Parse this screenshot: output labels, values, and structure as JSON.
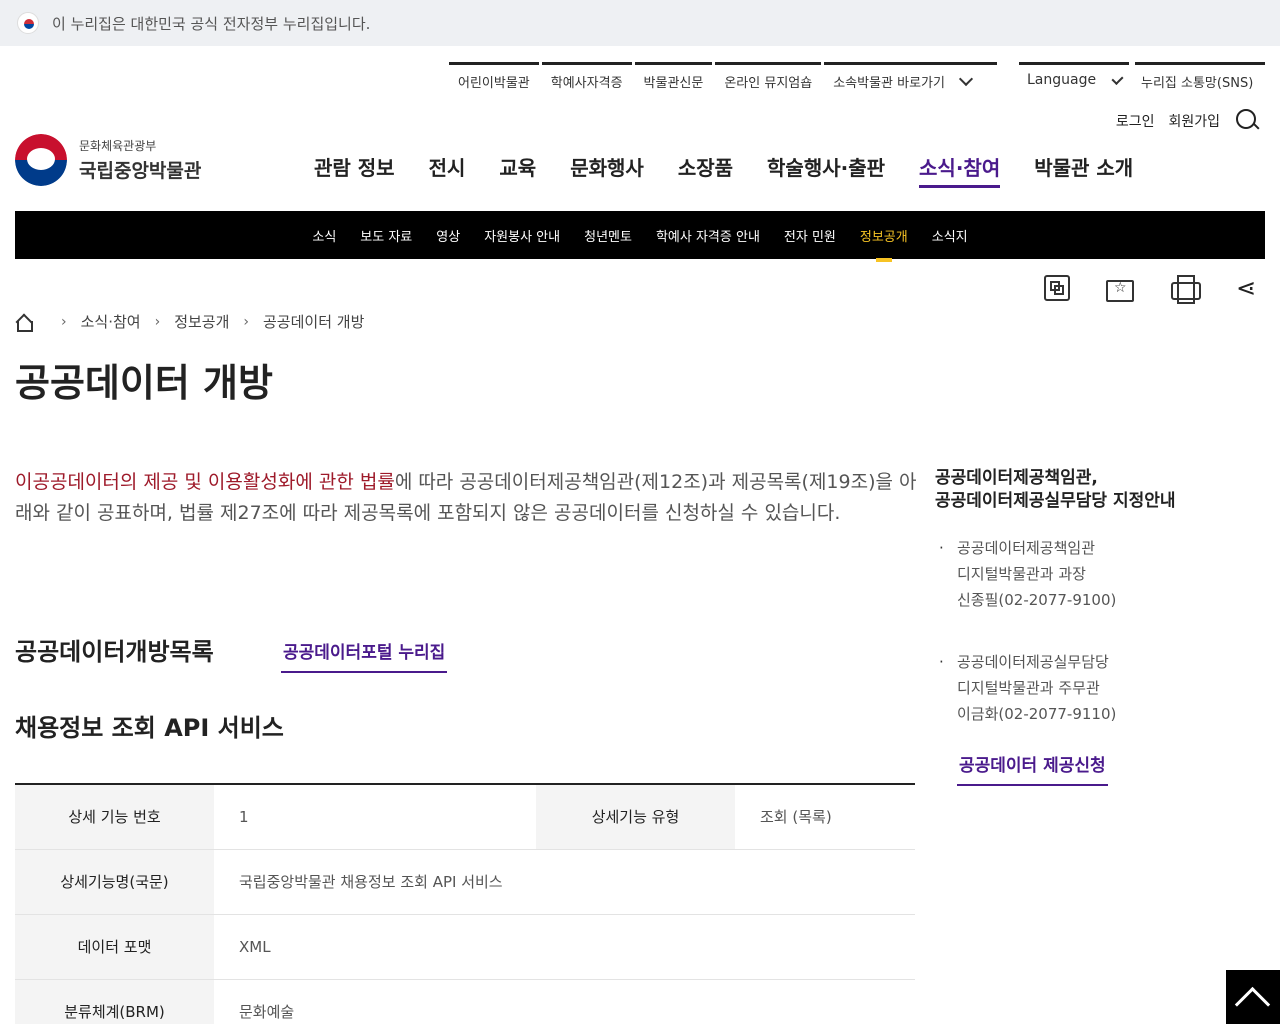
{
  "gov_banner": {
    "text": "이 누리집은 대한민국 공식 전자정부 누리집입니다."
  },
  "utility": {
    "links": [
      "어린이박물관",
      "학예사자격증",
      "박물관신문",
      "온라인 뮤지엄숍",
      "소속박물관 바로가기"
    ],
    "language": "Language",
    "sns": "누리집 소통망(SNS)",
    "login": "로그인",
    "signup": "회원가입"
  },
  "logo": {
    "sub": "문화체육관광부",
    "main": "국립중앙박물관"
  },
  "gnb": [
    "관람 정보",
    "전시",
    "교육",
    "문화행사",
    "소장품",
    "학술행사·출판",
    "소식·참여",
    "박물관 소개"
  ],
  "gnb_active": "소식·참여",
  "subnav": [
    "소식",
    "보도 자료",
    "영상",
    "자원봉사 안내",
    "청년멘토",
    "학예사 자격증 안내",
    "전자 민원",
    "정보공개",
    "소식지"
  ],
  "subnav_active": "정보공개",
  "breadcrumb": [
    "소식·참여",
    "정보공개",
    "공공데이터 개방"
  ],
  "page_title": "공공데이터 개방",
  "intro": {
    "law": "이공공데이터의 제공 및 이용활성화에 관한 법률",
    "rest": "에 따라 공공데이터제공책임관(제12조)과 제공목록(제19조)을 아래와 같이 공표하며, 법률 제27조에 따라 제공목록에 포함되지 않은 공공데이터를 신청하실 수 있습니다."
  },
  "open_list": {
    "heading": "공공데이터개방목록",
    "portal_link": "공공데이터포털 누리집"
  },
  "api": {
    "heading": "채용정보 조회 API 서비스",
    "rows": [
      {
        "label": "상세 기능 번호",
        "value": "1",
        "label2": "상세기능 유형",
        "value2": "조회 (목록)"
      },
      {
        "label": "상세기능명(국문)",
        "value": "국립중앙박물관 채용정보 조회 API 서비스"
      },
      {
        "label": "데이터 포맷",
        "value": "XML"
      },
      {
        "label": "분류체계(BRM)",
        "value": "문화예술"
      }
    ]
  },
  "sidebar": {
    "title_line1": "공공데이터제공책임관,",
    "title_line2": "공공데이터제공실무담당 지정안내",
    "items": [
      {
        "role": "공공데이터제공책임관",
        "dept": "디지털박물관과 과장",
        "person": "신종필(02-2077-9100)"
      },
      {
        "role": "공공데이터제공실무담당",
        "dept": "디지털박물관과 주무관",
        "person": "이금화(02-2077-9110)"
      }
    ],
    "apply": "공공데이터 제공신청"
  },
  "colors": {
    "accent": "#4a1a8c",
    "law": "#9e1a2a",
    "subnav_active": "#f7c324"
  }
}
